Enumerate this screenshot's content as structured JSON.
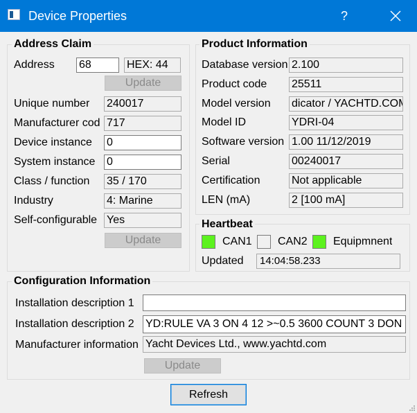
{
  "window": {
    "title": "Device Properties",
    "help_label": "?"
  },
  "address_claim": {
    "title": "Address Claim",
    "address_label": "Address",
    "address_value": "68",
    "hex_value": "HEX: 44",
    "update_label": "Update",
    "unique_number_label": "Unique number",
    "unique_number_value": "240017",
    "manufacturer_code_label": "Manufacturer cod",
    "manufacturer_code_value": "717",
    "device_instance_label": "Device instance",
    "device_instance_value": "0",
    "system_instance_label": "System instance",
    "system_instance_value": "0",
    "class_function_label": "Class / function",
    "class_function_value": "35 / 170",
    "industry_label": "Industry",
    "industry_value": "4: Marine",
    "self_configurable_label": "Self-configurable",
    "self_configurable_value": "Yes",
    "update2_label": "Update"
  },
  "product_information": {
    "title": "Product Information",
    "database_version_label": "Database version",
    "database_version_value": "2.100",
    "product_code_label": "Product code",
    "product_code_value": "25511",
    "model_version_label": "Model version",
    "model_version_value": "dicator / YACHTD.COM",
    "model_id_label": "Model ID",
    "model_id_value": "YDRI-04",
    "software_version_label": "Software version",
    "software_version_value": "1.00 11/12/2019",
    "serial_label": "Serial",
    "serial_value": "00240017",
    "certification_label": "Certification",
    "certification_value": "Not applicable",
    "len_label": "LEN (mA)",
    "len_value": "2 [100 mA]"
  },
  "heartbeat": {
    "title": "Heartbeat",
    "can1_label": "CAN1",
    "can1_on": true,
    "can2_label": "CAN2",
    "can2_on": false,
    "equipment_label": "Equipmnent",
    "equipment_on": true,
    "updated_label": "Updated",
    "updated_value": "14:04:58.233"
  },
  "configuration_information": {
    "title": "Configuration Information",
    "installation_description_1_label": "Installation description 1",
    "installation_description_1_value": "",
    "installation_description_2_label": "Installation description 2",
    "installation_description_2_value": "YD:RULE VA 3 ON 4 12 >~0.5 3600 COUNT 3 DON",
    "manufacturer_information_label": "Manufacturer information",
    "manufacturer_information_value": "Yacht Devices Ltd., www.yachtd.com",
    "update_label": "Update"
  },
  "refresh_label": "Refresh",
  "colors": {
    "titlebar": "#0078d7",
    "led_on": "#5cf21e",
    "window_bg": "#f0f0f0"
  }
}
